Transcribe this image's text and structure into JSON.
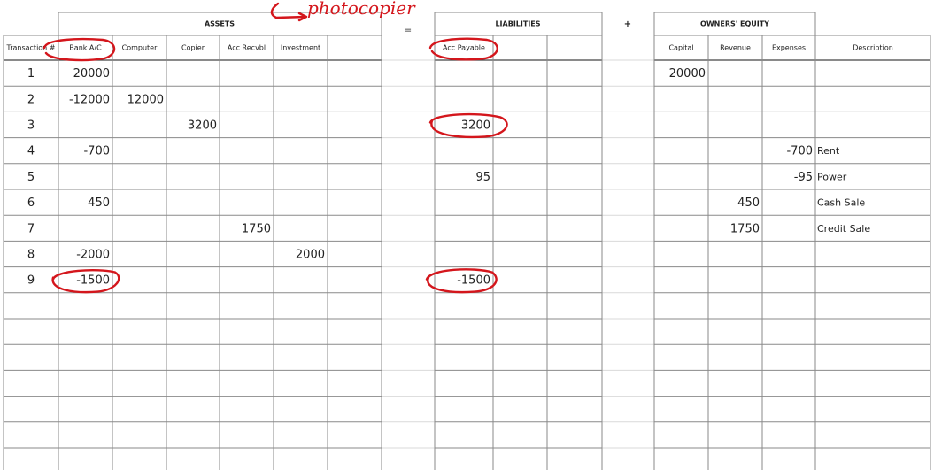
{
  "sheet": {
    "headers": {
      "assets": "ASSETS",
      "equals": "=",
      "liabilities": "LIABILITIES",
      "plus": "+",
      "owners_equity": "OWNERS' EQUITY"
    },
    "columns": {
      "transaction": "Transaction #",
      "bank": "Bank A/C",
      "computer": "Computer",
      "copier": "Copier",
      "acc_recvbl": "Acc Recvbl",
      "investment": "Investment",
      "acc_payable": "Acc Payable",
      "capital": "Capital",
      "revenue": "Revenue",
      "expenses": "Expenses",
      "description": "Description"
    },
    "rows": [
      {
        "txn": "1",
        "bank": "20000",
        "computer": "",
        "copier": "",
        "acc_recvbl": "",
        "investment": "",
        "acc_payable": "",
        "capital": "20000",
        "revenue": "",
        "expenses": "",
        "description": ""
      },
      {
        "txn": "2",
        "bank": "-12000",
        "computer": "12000",
        "copier": "",
        "acc_recvbl": "",
        "investment": "",
        "acc_payable": "",
        "capital": "",
        "revenue": "",
        "expenses": "",
        "description": ""
      },
      {
        "txn": "3",
        "bank": "",
        "computer": "",
        "copier": "3200",
        "acc_recvbl": "",
        "investment": "",
        "acc_payable": "3200",
        "capital": "",
        "revenue": "",
        "expenses": "",
        "description": ""
      },
      {
        "txn": "4",
        "bank": "-700",
        "computer": "",
        "copier": "",
        "acc_recvbl": "",
        "investment": "",
        "acc_payable": "",
        "capital": "",
        "revenue": "",
        "expenses": "-700",
        "description": "Rent"
      },
      {
        "txn": "5",
        "bank": "",
        "computer": "",
        "copier": "",
        "acc_recvbl": "",
        "investment": "",
        "acc_payable": "95",
        "capital": "",
        "revenue": "",
        "expenses": "-95",
        "description": "Power"
      },
      {
        "txn": "6",
        "bank": "450",
        "computer": "",
        "copier": "",
        "acc_recvbl": "",
        "investment": "",
        "acc_payable": "",
        "capital": "",
        "revenue": "450",
        "expenses": "",
        "description": "Cash Sale"
      },
      {
        "txn": "7",
        "bank": "",
        "computer": "",
        "copier": "",
        "acc_recvbl": "1750",
        "investment": "",
        "acc_payable": "",
        "capital": "",
        "revenue": "1750",
        "expenses": "",
        "description": "Credit Sale"
      },
      {
        "txn": "8",
        "bank": "-2000",
        "computer": "",
        "copier": "",
        "acc_recvbl": "",
        "investment": "2000",
        "acc_payable": "",
        "capital": "",
        "revenue": "",
        "expenses": "",
        "description": ""
      },
      {
        "txn": "9",
        "bank": "-1500",
        "computer": "",
        "copier": "",
        "acc_recvbl": "",
        "investment": "",
        "acc_payable": "-1500",
        "capital": "",
        "revenue": "",
        "expenses": "",
        "description": ""
      },
      {
        "txn": "",
        "bank": "",
        "computer": "",
        "copier": "",
        "acc_recvbl": "",
        "investment": "",
        "acc_payable": "",
        "capital": "",
        "revenue": "",
        "expenses": "",
        "description": ""
      },
      {
        "txn": "",
        "bank": "",
        "computer": "",
        "copier": "",
        "acc_recvbl": "",
        "investment": "",
        "acc_payable": "",
        "capital": "",
        "revenue": "",
        "expenses": "",
        "description": ""
      },
      {
        "txn": "",
        "bank": "",
        "computer": "",
        "copier": "",
        "acc_recvbl": "",
        "investment": "",
        "acc_payable": "",
        "capital": "",
        "revenue": "",
        "expenses": "",
        "description": ""
      },
      {
        "txn": "",
        "bank": "",
        "computer": "",
        "copier": "",
        "acc_recvbl": "",
        "investment": "",
        "acc_payable": "",
        "capital": "",
        "revenue": "",
        "expenses": "",
        "description": ""
      },
      {
        "txn": "",
        "bank": "",
        "computer": "",
        "copier": "",
        "acc_recvbl": "",
        "investment": "",
        "acc_payable": "",
        "capital": "",
        "revenue": "",
        "expenses": "",
        "description": ""
      },
      {
        "txn": "",
        "bank": "",
        "computer": "",
        "copier": "",
        "acc_recvbl": "",
        "investment": "",
        "acc_payable": "",
        "capital": "",
        "revenue": "",
        "expenses": "",
        "description": ""
      },
      {
        "txn": "",
        "bank": "",
        "computer": "",
        "copier": "",
        "acc_recvbl": "",
        "investment": "",
        "acc_payable": "",
        "capital": "",
        "revenue": "",
        "expenses": "",
        "description": ""
      }
    ]
  },
  "annotations": {
    "handwritten_note": "photocopier",
    "ink_color": "#d4161c",
    "circled_cells": [
      "Bank A/C",
      "Acc Payable",
      "3200",
      "-1500",
      "-1500"
    ]
  },
  "colors": {
    "grid_line": "#8a8a8a",
    "light_grid": "#d9d9d9",
    "text": "#222222",
    "background": "#ffffff"
  }
}
